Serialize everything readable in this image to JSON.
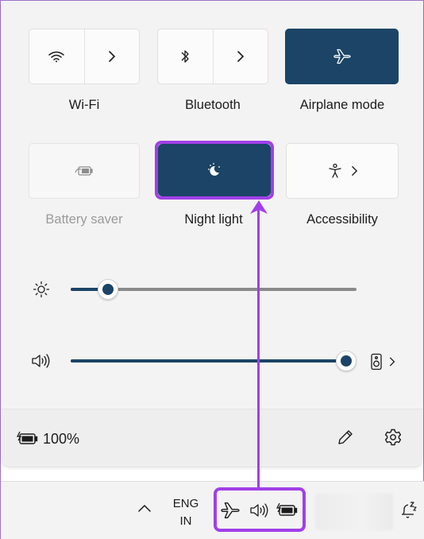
{
  "tiles": {
    "wifi": {
      "label": "Wi-Fi"
    },
    "bluetooth": {
      "label": "Bluetooth"
    },
    "airplane": {
      "label": "Airplane mode"
    },
    "battery_saver": {
      "label": "Battery saver"
    },
    "night_light": {
      "label": "Night light"
    },
    "accessibility": {
      "label": "Accessibility"
    }
  },
  "sliders": {
    "brightness": {
      "value_fraction": 0.13
    },
    "volume": {
      "value_fraction": 1.0
    }
  },
  "footer": {
    "battery_percent": "100%"
  },
  "taskbar": {
    "lang_line1": "ENG",
    "lang_line2": "IN"
  },
  "colors": {
    "accent": "#1b4466",
    "highlight": "#a13fe8"
  },
  "icons": [
    "wifi-icon",
    "chevron-right-icon",
    "bluetooth-icon",
    "airplane-icon",
    "battery-saver-icon",
    "night-light-icon",
    "accessibility-icon",
    "brightness-icon",
    "speaker-icon",
    "audio-output-icon",
    "battery-icon",
    "pencil-icon",
    "gear-icon",
    "chevron-up-icon",
    "notification-snooze-icon"
  ]
}
